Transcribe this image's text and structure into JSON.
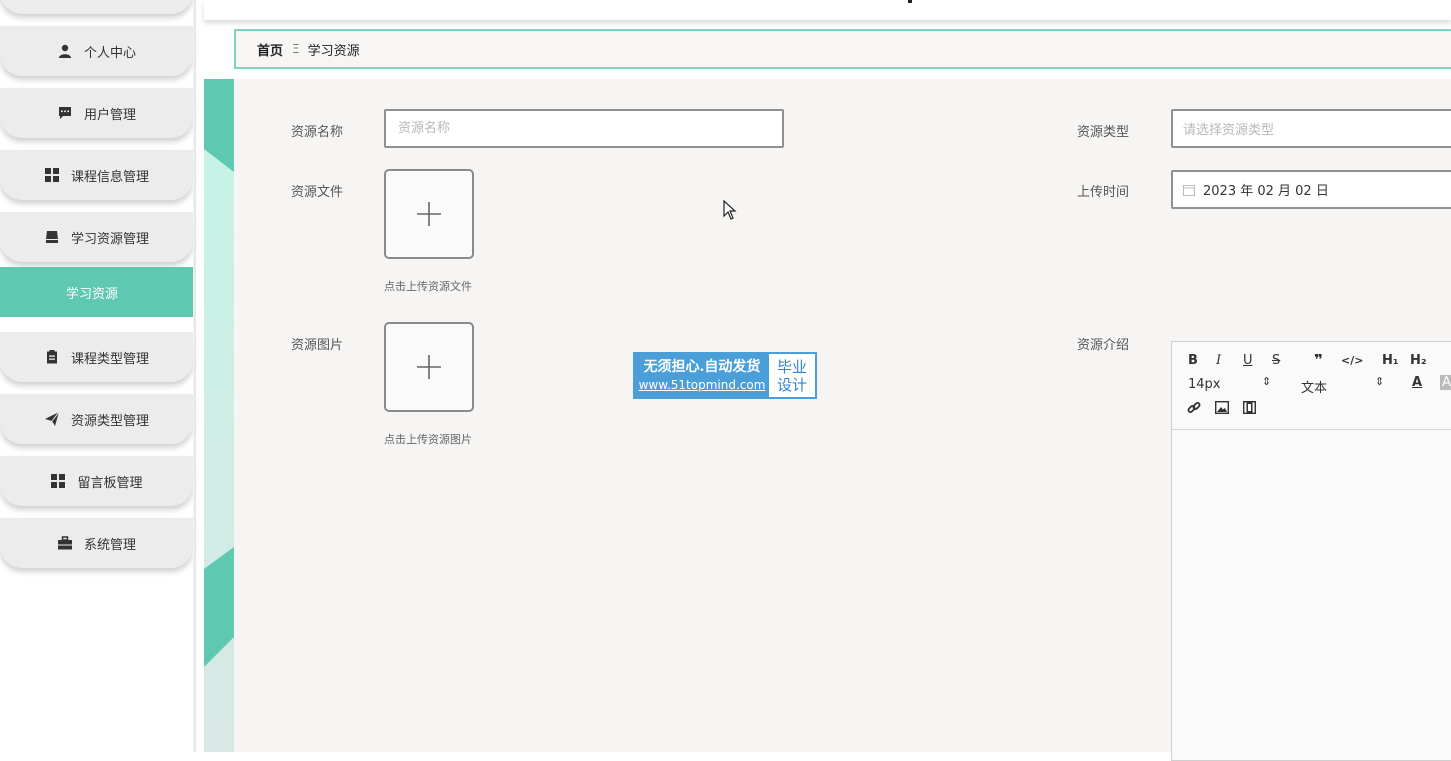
{
  "sidebar": {
    "items": [
      {
        "label": "个人中心",
        "icon": "user-icon"
      },
      {
        "label": "用户管理",
        "icon": "message-icon"
      },
      {
        "label": "课程信息管理",
        "icon": "grid-icon"
      },
      {
        "label": "学习资源管理",
        "icon": "inbox-icon"
      },
      {
        "label": "学习资源",
        "active": true
      },
      {
        "label": "课程类型管理",
        "icon": "clipboard-icon"
      },
      {
        "label": "资源类型管理",
        "icon": "send-icon"
      },
      {
        "label": "留言板管理",
        "icon": "grid-icon"
      },
      {
        "label": "系统管理",
        "icon": "briefcase-icon"
      }
    ]
  },
  "breadcrumb": {
    "home": "首页",
    "separator": "Ξ",
    "current": "学习资源"
  },
  "form": {
    "name_label": "资源名称",
    "name_placeholder": "资源名称",
    "type_label": "资源类型",
    "type_placeholder": "请选择资源类型",
    "file_label": "资源文件",
    "file_hint": "点击上传资源文件",
    "time_label": "上传时间",
    "time_value": "2023 年 02 月 02 日",
    "image_label": "资源图片",
    "image_hint": "点击上传资源图片",
    "intro_label": "资源介绍"
  },
  "editor": {
    "buttons": [
      "B",
      "I",
      "U",
      "S",
      "❞",
      "</>",
      "H₁",
      "H₂"
    ],
    "font_size": "14px",
    "text_type": "文本"
  },
  "watermark": {
    "line1": "无须担心.自动发货",
    "line2": "www.51topmind.com",
    "right1": "毕业",
    "right2": "设计"
  },
  "colors": {
    "accent": "#5ec8b0",
    "breadcrumb_border": "#7fd3c0",
    "watermark": "#4a9fd8"
  }
}
